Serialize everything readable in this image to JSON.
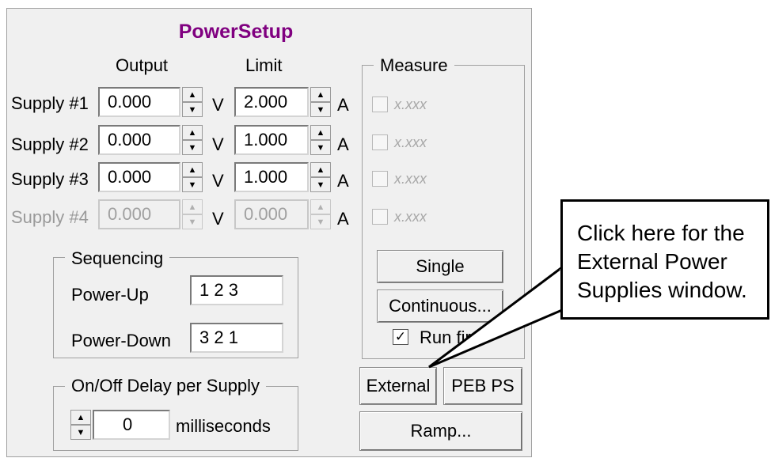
{
  "title": "PowerSetup",
  "headers": {
    "output": "Output",
    "limit": "Limit"
  },
  "supplies": [
    {
      "label": "Supply #1",
      "output": "0.000",
      "output_unit": "V",
      "limit": "2.000",
      "limit_unit": "A",
      "measure": "x.xxx"
    },
    {
      "label": "Supply #2",
      "output": "0.000",
      "output_unit": "V",
      "limit": "1.000",
      "limit_unit": "A",
      "measure": "x.xxx"
    },
    {
      "label": "Supply #3",
      "output": "0.000",
      "output_unit": "V",
      "limit": "1.000",
      "limit_unit": "A",
      "measure": "x.xxx"
    },
    {
      "label": "Supply #4",
      "output": "0.000",
      "output_unit": "V",
      "limit": "0.000",
      "limit_unit": "A",
      "measure": "x.xxx"
    }
  ],
  "measure": {
    "title": "Measure",
    "single_label": "Single",
    "continuous_label": "Continuous...",
    "run_first_label": "Run first",
    "run_first_checked": "✓"
  },
  "sequencing": {
    "title": "Sequencing",
    "power_up_label": "Power-Up",
    "power_up_value": "1 2 3",
    "power_down_label": "Power-Down",
    "power_down_value": "3 2 1"
  },
  "delay": {
    "title": "On/Off Delay per Supply",
    "value": "0",
    "unit": "milliseconds"
  },
  "buttons": {
    "external": "External",
    "peb_ps": "PEB PS",
    "ramp": "Ramp..."
  },
  "icons": {
    "spin_up": "▲",
    "spin_down": "▼"
  },
  "callout": {
    "lines": [
      "Click here for the",
      "External Power",
      "Supplies window."
    ]
  }
}
